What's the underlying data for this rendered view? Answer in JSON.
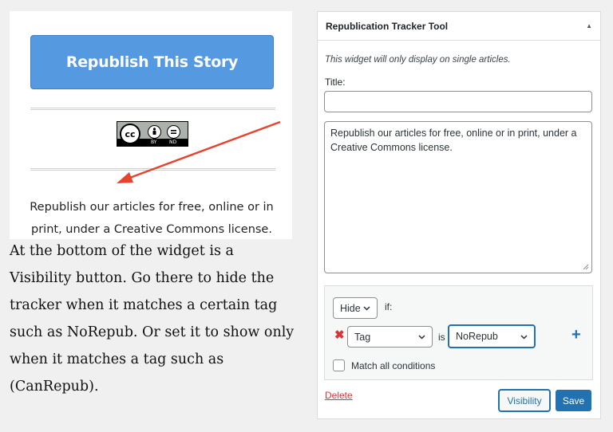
{
  "preview": {
    "republish_button": "Republish This Story",
    "license_badge": {
      "circle": "cc",
      "by": "BY",
      "nd": "ND"
    },
    "description": "Republish our articles for free, online or in print, under a Creative Commons license."
  },
  "explanation": "At the bottom of the widget is a Visibility button. Go there to hide the tracker when it matches a certain tag such as NoRepub. Or set it to show only when it matches a tag such as (CanRepub).",
  "widget": {
    "header_title": "Republication Tracker Tool",
    "note": "This widget will only display on single articles.",
    "title_label": "Title:",
    "title_value": "",
    "description_value": "Republish our articles for free, online or in print, under a Creative Commons license.",
    "visibility": {
      "action": "Hide",
      "if_label": "if:",
      "condition_type": "Tag",
      "is_label": "is",
      "condition_value": "NoRepub",
      "match_all_label": "Match all conditions",
      "match_all_checked": false
    },
    "delete_label": "Delete",
    "visibility_button": "Visibility",
    "save_button": "Save"
  },
  "colors": {
    "republish_blue": "#5599e0",
    "wp_blue": "#2271b1",
    "delete_red": "#d63638",
    "arrow_red": "#e8432f"
  }
}
